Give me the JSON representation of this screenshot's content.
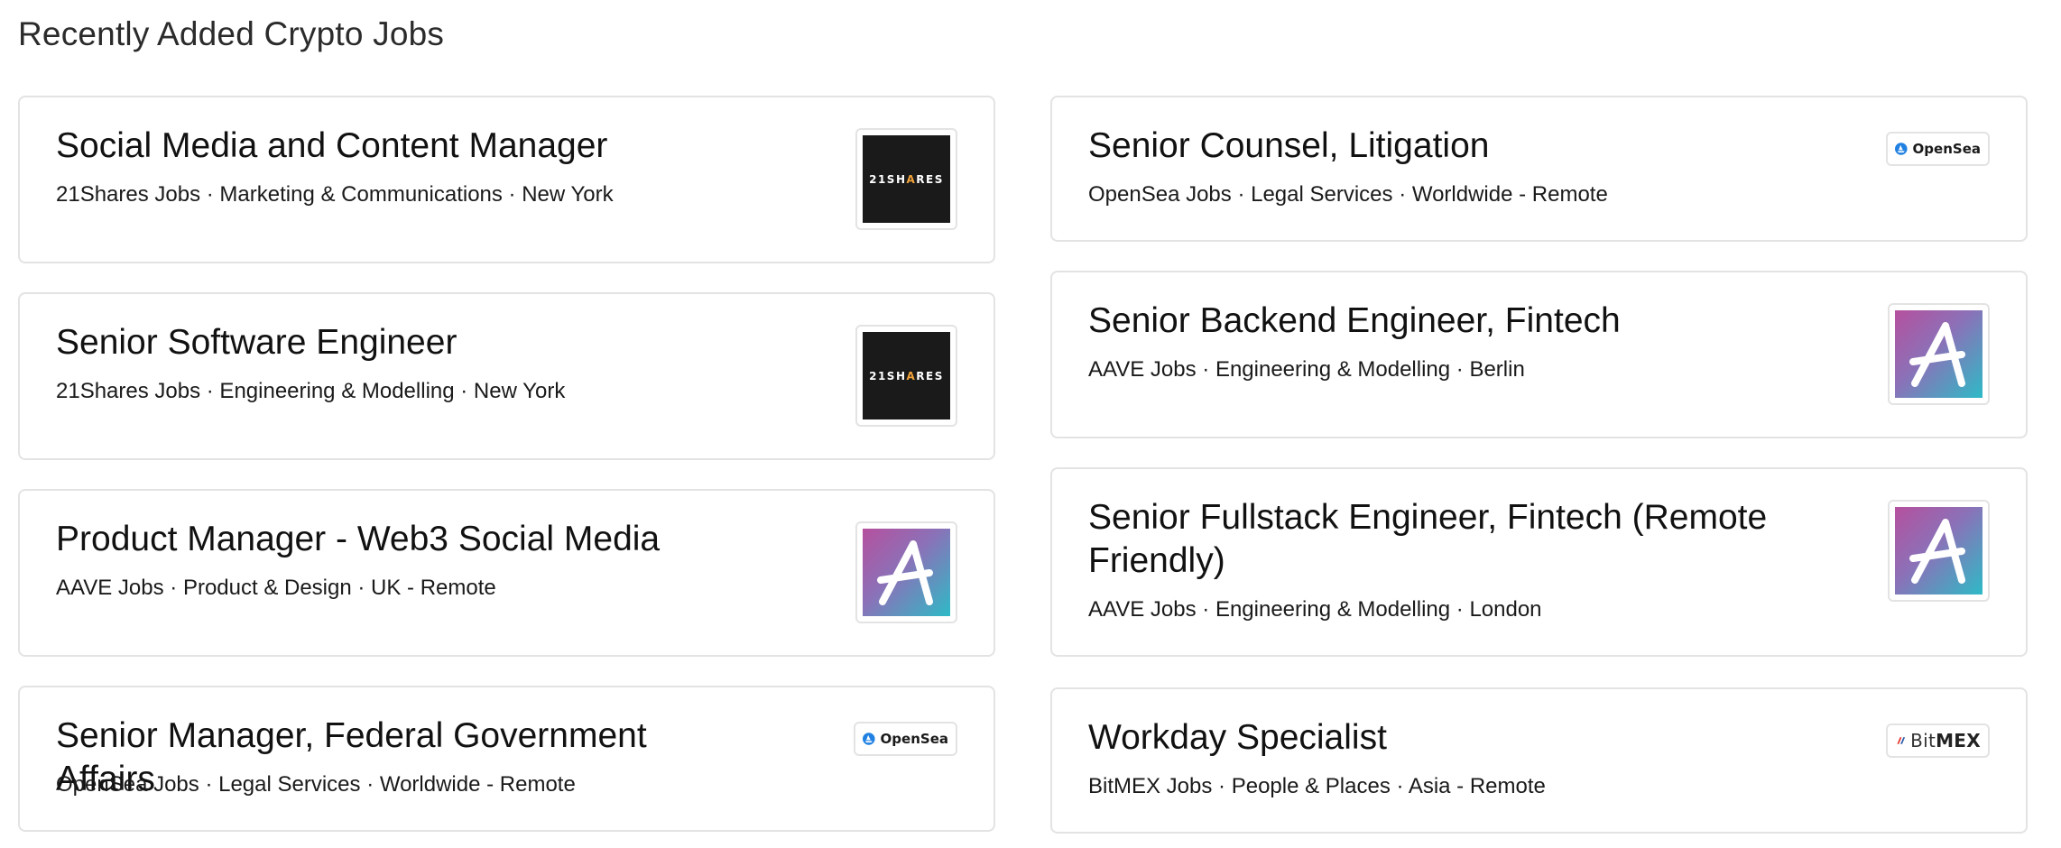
{
  "section_title": "Recently Added Crypto Jobs",
  "logos": {
    "21shares": {
      "text_a": "21SH",
      "text_b": "A",
      "text_c": "RES",
      "bg": "#1a1a1a",
      "accent": "#f2a33a"
    },
    "opensea": {
      "text": "OpenSea",
      "color": "#2081e2"
    },
    "bitmex": {
      "text_a": "Bit",
      "text_b": "MEX",
      "accent": "#e5332a"
    },
    "aave": {
      "gradient": [
        "#b6509e",
        "#2ebac6"
      ]
    }
  },
  "jobs_left": [
    {
      "title": "Social Media and Content Manager",
      "meta": "21Shares Jobs · Marketing & Communications · New York",
      "logo": "21shares"
    },
    {
      "title": "Senior Software Engineer",
      "meta": "21Shares Jobs · Engineering & Modelling · New York",
      "logo": "21shares"
    },
    {
      "title": "Product Manager - Web3 Social Media",
      "meta": "AAVE Jobs · Product & Design · UK - Remote",
      "logo": "aave"
    },
    {
      "title": "Senior Manager, Federal Government Affairs",
      "meta": "OpenSea Jobs · Legal Services · Worldwide - Remote",
      "logo": "opensea"
    }
  ],
  "jobs_right": [
    {
      "title": "Senior Counsel, Litigation",
      "meta": "OpenSea Jobs · Legal Services · Worldwide - Remote",
      "logo": "opensea"
    },
    {
      "title": "Senior Backend Engineer, Fintech",
      "meta": "AAVE Jobs · Engineering & Modelling · Berlin",
      "logo": "aave"
    },
    {
      "title": "Senior Fullstack Engineer, Fintech (Remote Friendly)",
      "meta": "AAVE Jobs · Engineering & Modelling · London",
      "logo": "aave"
    },
    {
      "title": "Workday Specialist",
      "meta": "BitMEX Jobs · People & Places · Asia - Remote",
      "logo": "bitmex"
    }
  ]
}
